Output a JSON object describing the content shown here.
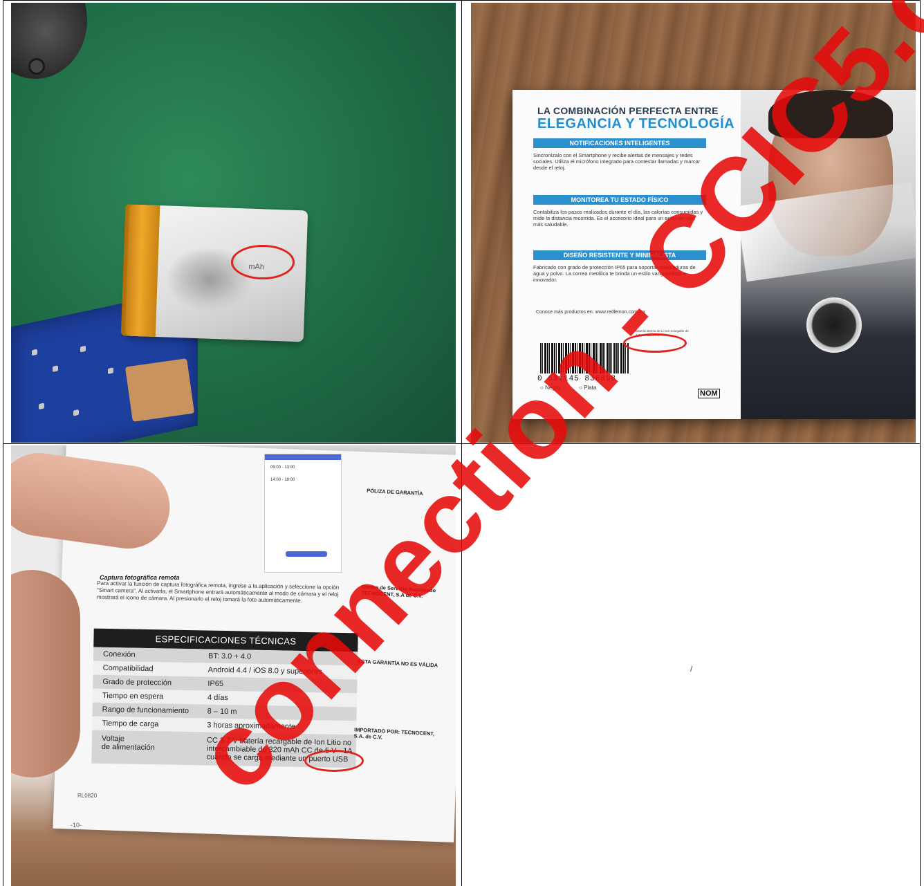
{
  "panel_battery": {
    "label_text": "mAh"
  },
  "panel_box": {
    "headline_1": "LA COMBINACIÓN PERFECTA ENTRE",
    "headline_2": "ELEGANCIA Y TECNOLOGÍA",
    "sections": [
      {
        "title": "NOTIFICACIONES INTELIGENTES",
        "text": "Sincronízalo con el Smartphone y recibe alertas de mensajes y redes sociales. Utiliza el micrófono integrado para contestar llamadas y marcar desde el reloj."
      },
      {
        "title": "MONITOREA TU ESTADO FÍSICO",
        "text": "Contabiliza los pasos realizados durante el día, las calorías consumidas y mide la distancia recorrida. Es el accesorio ideal para un estilo de vida más saludable."
      },
      {
        "title": "DISEÑO RESISTENTE Y MINIMALISTA",
        "text": "Fabricado con grado de protección IP65 para soportar salpicaduras de agua y polvo. La correa metálica te brinda un estilo vanguardista e innovador."
      }
    ],
    "url_line": "Conoce más productos en: www.redlemon.com.mx",
    "barcode_number": "0 631145 836898",
    "color_options": [
      "Negro",
      "Plata"
    ],
    "spec_small": "Batería interna de Li-ion recargable de 3.7V --- 320 mAh",
    "nom_label": "NOM"
  },
  "panel_manual": {
    "paragraph_title": "Captura fotográfica remota",
    "paragraph_text": "Para activar la función de captura fotográfica remota, ingrese a la aplicación y seleccione la opción \"Smart camera\". Al activarla, el Smartphone entrará automáticamente al modo de cámara y el reloj mostrará el icono de cámara. Al presionarlo el reloj tomará la foto automáticamente.",
    "spec_title": "ESPECIFICACIONES TÉCNICAS",
    "specs": [
      {
        "key": "Conexión",
        "value": "BT: 3.0 + 4.0"
      },
      {
        "key": "Compatibilidad",
        "value": "Android 4.4 / iOS 8.0 y superiores"
      },
      {
        "key": "Grado de protección",
        "value": "IP65"
      },
      {
        "key": "Tiempo en espera",
        "value": "4 días"
      },
      {
        "key": "Rango de funcionamiento",
        "value": "8 – 10 m"
      },
      {
        "key": "Tiempo de carga",
        "value": "3 horas aproximadamente"
      },
      {
        "key": "Voltaje\nde alimentación",
        "value": "CC 3.7 V batería recargable de Ion Litio no intercambiable de 320 mAh CC de 5 V - 1A cuando se carga mediante un puerto USB"
      }
    ],
    "footer_code": "RL0820",
    "page_number": "-10-",
    "side_heading": "PÓLIZA DE GARANTÍA",
    "side_service": "Centro de Servicio Autorizado TECNOCENT, S.A de C.V.",
    "side_warranty": "ESTA GARANTÍA NO ES VÁLIDA",
    "side_imported": "IMPORTADO POR: TECNOCENT, S.A. de C.V.",
    "phone_times": [
      "09:00 - 13:00",
      "14:00 - 18:00"
    ]
  },
  "watermark": "connection - CCIC5.com",
  "empty_cell_mark": "/"
}
